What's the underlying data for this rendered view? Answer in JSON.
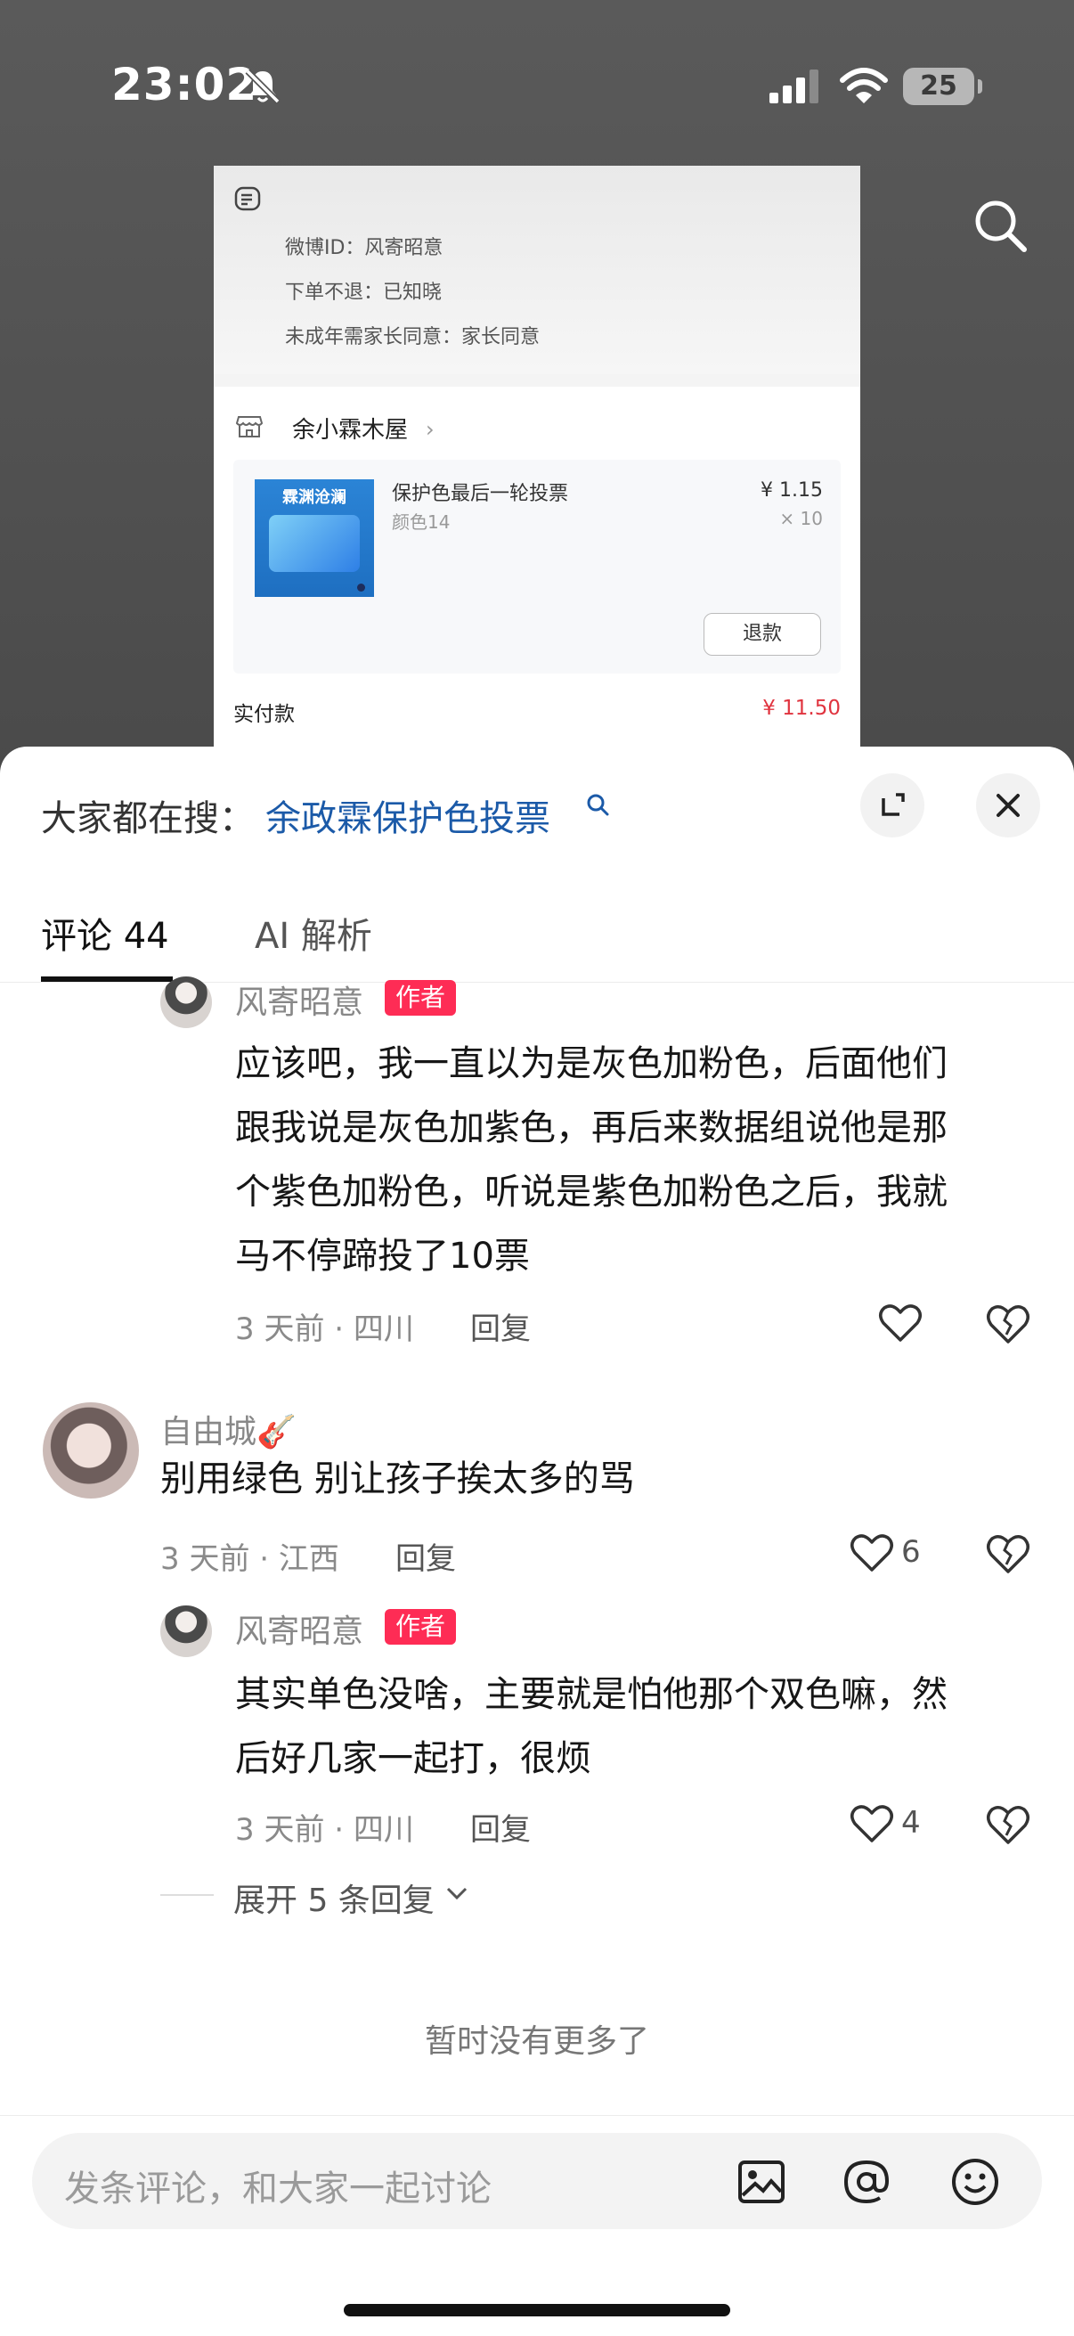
{
  "status_bar": {
    "time": "23:02",
    "battery": "25"
  },
  "order_card": {
    "weibo_id_line": "微博ID：风寄昭意",
    "no_refund_line": "下单不退：已知晓",
    "minor_line": "未成年需家长同意：家长同意",
    "shop_name": "余小霖木屋",
    "thumb_title": "霖渊沧澜",
    "item_title": "保护色最后一轮投票",
    "item_variant": "颜色14",
    "item_price": "¥ 1.15",
    "item_qty": "× 10",
    "refund_label": "退款",
    "paid_label": "实付款",
    "paid_value": "¥ 11.50"
  },
  "sheet": {
    "hot_search_label": "大家都在搜：",
    "hot_search_term": "余政霖保护色投票",
    "tabs": {
      "comments": "评论 44",
      "ai": "AI 解析"
    },
    "comments": [
      {
        "user": "风寄昭意",
        "badge": "作者",
        "text_lines": [
          "应该吧，我一直以为是灰色加粉色，后面他们",
          "跟我说是灰色加紫色，再后来数据组说他是那",
          "个紫色加粉色，听说是紫色加粉色之后，我就",
          "马不停蹄投了10票"
        ],
        "meta": "3 天前 · 四川",
        "reply": "回复"
      },
      {
        "user": "自由城🎸",
        "text_lines": [
          "别用绿色 别让孩子挨太多的骂"
        ],
        "meta": "3 天前 · 江西",
        "reply": "回复",
        "likes": "6"
      },
      {
        "user": "风寄昭意",
        "badge": "作者",
        "text_lines": [
          "其实单色没啥，主要就是怕他那个双色嘛，然",
          "后好几家一起打，很烦"
        ],
        "meta": "3 天前 · 四川",
        "reply": "回复",
        "likes": "4"
      }
    ],
    "expand_replies": "展开 5 条回复",
    "no_more": "暂时没有更多了",
    "input_placeholder": "发条评论，和大家一起讨论"
  }
}
